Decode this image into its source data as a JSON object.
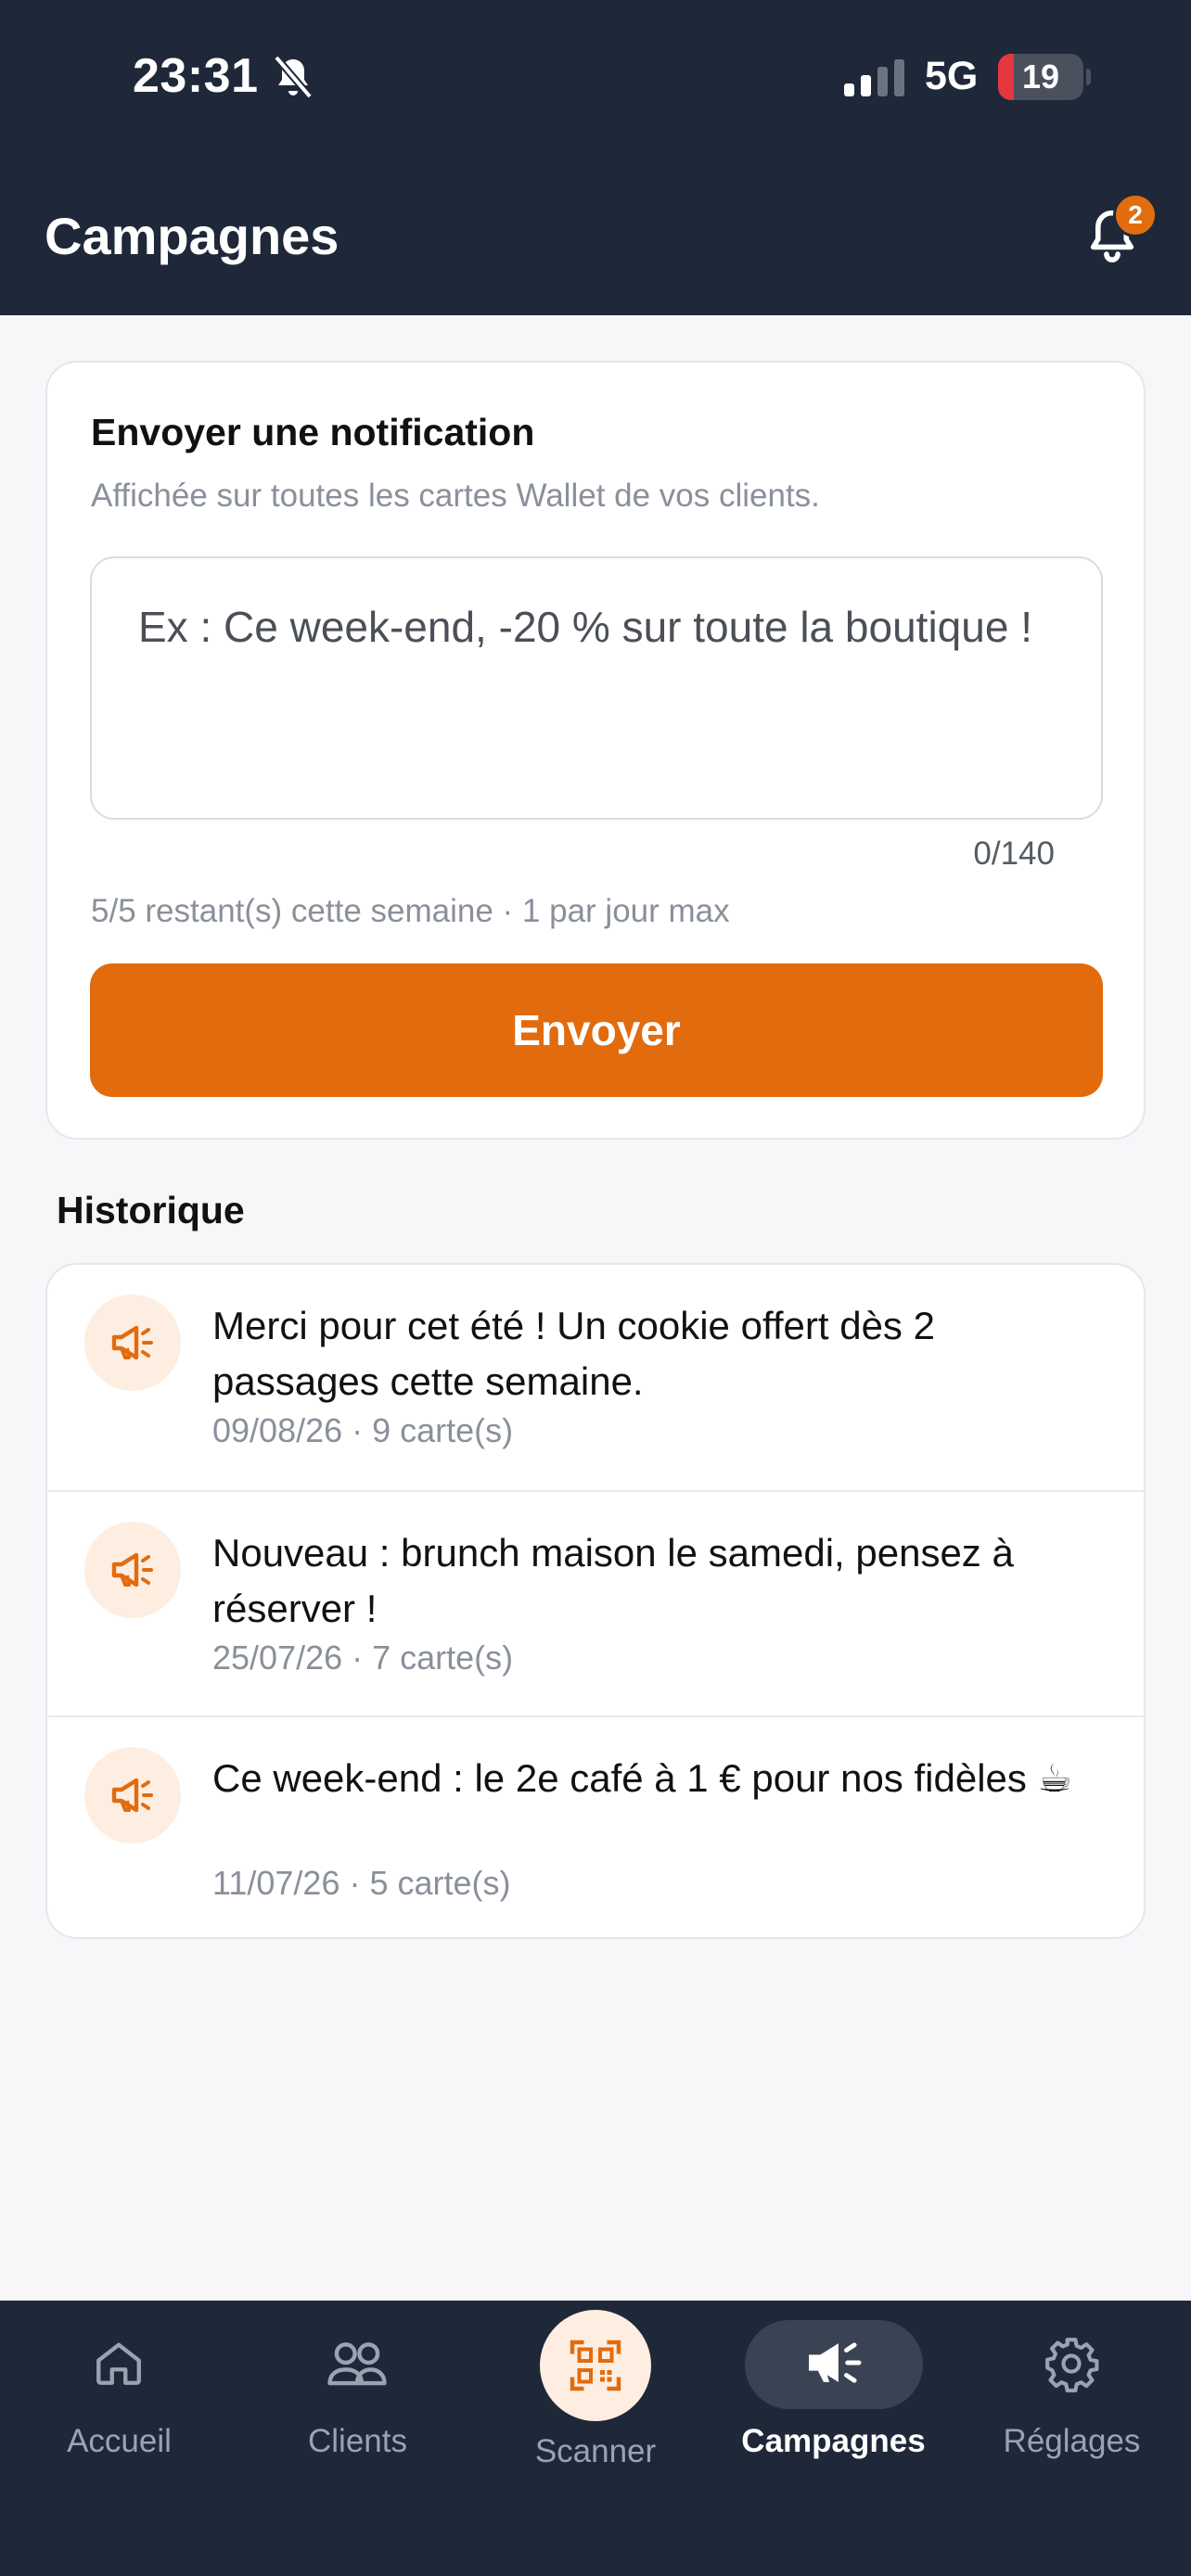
{
  "status_bar": {
    "time": "23:31",
    "network": "5G",
    "battery": "19",
    "battery_level_percent": 19
  },
  "header": {
    "title": "Campagnes",
    "notification_count": "2"
  },
  "compose": {
    "title": "Envoyer une notification",
    "subtitle": "Affichée sur toutes les cartes Wallet de vos clients.",
    "placeholder": "Ex : Ce week-end, -20 % sur toute la boutique !",
    "value": "",
    "counter": "0/140",
    "quota": "5/5 restant(s) cette semaine · 1 par jour max",
    "send_label": "Envoyer"
  },
  "history": {
    "title": "Historique",
    "items": [
      {
        "message": "Merci pour cet été ! Un cookie offert dès 2 passages cette semaine.",
        "meta": "09/08/26 · 9 carte(s)"
      },
      {
        "message": "Nouveau : brunch maison le samedi, pensez à réserver !",
        "meta": "25/07/26 · 7 carte(s)"
      },
      {
        "message": "Ce week-end : le 2e café à 1 € pour nos fidèles ☕",
        "meta": "11/07/26 · 5 carte(s)"
      }
    ]
  },
  "tabbar": {
    "items": [
      {
        "label": "Accueil",
        "icon": "home-icon"
      },
      {
        "label": "Clients",
        "icon": "users-icon"
      },
      {
        "label": "Scanner",
        "icon": "qr-code-icon"
      },
      {
        "label": "Campagnes",
        "icon": "megaphone-icon",
        "active": true
      },
      {
        "label": "Réglages",
        "icon": "gear-icon"
      }
    ]
  },
  "colors": {
    "header_bg": "#1f2839",
    "accent": "#e26b0e",
    "accent_soft": "#fdeee1",
    "page_bg": "#f7f7f9"
  }
}
